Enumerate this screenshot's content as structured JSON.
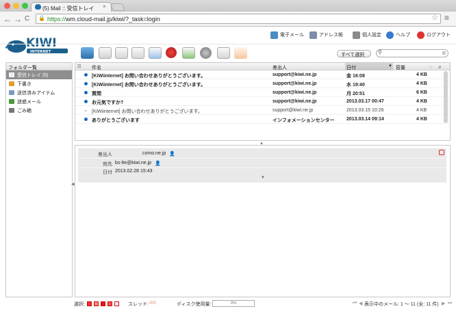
{
  "browser": {
    "tab_title": "(5) Mail :: 受信トレイ",
    "tab_close": "×",
    "url_scheme": "https://",
    "url_rest": "wm.cloud-mail.jp/kiwi/?_task=login",
    "back": "←",
    "forward": "→",
    "reload": "C",
    "star": "☆",
    "menu": "≡"
  },
  "header": {
    "logo_text": "KIWI",
    "logo_sub": "INTERNET",
    "nav": {
      "email": "電子メール",
      "addressbook": "アドレス帳",
      "settings": "個人設定",
      "help": "ヘルプ",
      "logout": "ログアウト"
    }
  },
  "toolbar": {
    "quick_select": "すべて選択",
    "search_placeholder": ""
  },
  "folders": {
    "title": "フォルダー覧",
    "items": [
      {
        "label": "受信トレイ (5)",
        "icon": "inbox-icon",
        "color": "#5b7fbf"
      },
      {
        "label": "下書き",
        "icon": "pencil-icon",
        "color": "#e0a030"
      },
      {
        "label": "送信済みアイテム",
        "icon": "outbox-icon",
        "color": "#7a9ac0"
      },
      {
        "label": "迷惑メール",
        "icon": "junk-icon",
        "color": "#4a9a3a"
      },
      {
        "label": "ごみ箱",
        "icon": "trash-icon",
        "color": "#777"
      }
    ]
  },
  "list": {
    "columns": {
      "subject": "件名",
      "from": "差出人",
      "date": "日付",
      "size": "容量"
    },
    "rows": [
      {
        "subject": "[KiWiinternet] お問い合わせありがとうございます。",
        "from": "support@kiwi.ne.jp",
        "date": "金 16:08",
        "size": "4 KB",
        "unread": true
      },
      {
        "subject": "[KiWiinternet] お問い合わせありがとうございます。",
        "from": "support@kiwi.ne.jp",
        "date": "水 19:40",
        "size": "4 KB",
        "unread": true
      },
      {
        "subject": "質問",
        "from": "support@kiwi.ne.jp",
        "date": "月 20:51",
        "size": "6 KB",
        "unread": true
      },
      {
        "subject": "お元気ですか?",
        "from": "support@kiwi.ne.jp",
        "date": "2013.03.17 00:47",
        "size": "4 KB",
        "unread": true
      },
      {
        "subject": "[KiWiinternet] お問い合わせありがとうございます。",
        "from": "support@kiwi.ne.jp",
        "date": "2013.03.15 10:26",
        "size": "4 KB",
        "unread": false
      },
      {
        "subject": "ありがとうございます",
        "from": "インフォメーションセンター",
        "date": "2013.03.14 09:14",
        "size": "4 KB",
        "unread": true
      }
    ]
  },
  "preview": {
    "from_label": "差出人",
    "from_value": "como.ne.jp",
    "to_label": "宛先",
    "to_value": "bs-lte@kiwi.ne.jp",
    "date_label": "日付",
    "date_value": "2013.02.28 15:43"
  },
  "footer": {
    "select_label": "選択:",
    "thread_label": "スレッド:",
    "quota_label": "ディスク使用量:",
    "quota_value": "0%",
    "count_text": "表示中のメール: 1 ～ 11 (全: 11 件)"
  }
}
